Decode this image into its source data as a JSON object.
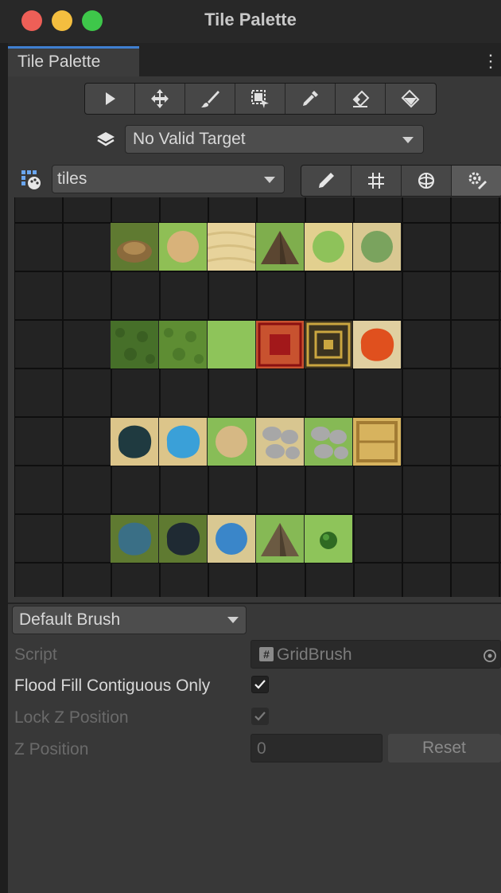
{
  "window": {
    "title": "Tile Palette"
  },
  "tab": {
    "label": "Tile Palette",
    "menu_glyph": "⋮"
  },
  "toolbar": {
    "tools": [
      "select-tool",
      "move-tool",
      "paint-brush-tool",
      "box-fill-tool",
      "pick-tool",
      "eraser-tool",
      "flood-fill-tool"
    ]
  },
  "target": {
    "value": "No Valid Target"
  },
  "palette": {
    "value": "tiles"
  },
  "palette_options": [
    "edit-pencil",
    "grid-toggle",
    "gizmo-toggle",
    "palette-settings"
  ],
  "tiles": [
    [
      {
        "name": "dirt-mound-tile",
        "bg": "#5f7a31",
        "fg": "#8b6a3c",
        "shape": "mound"
      },
      {
        "name": "grass-sand-patch-tile",
        "bg": "#8fbf55",
        "fg": "#d8b27a",
        "shape": "circle"
      },
      {
        "name": "sand-tile",
        "bg": "#e7d39b",
        "fg": "#d6bf82",
        "shape": "stripes"
      },
      {
        "name": "mountain-tile",
        "bg": "#7fae4d",
        "fg": "#5b4631",
        "shape": "peak"
      },
      {
        "name": "grass-on-sand-tile",
        "bg": "#e2d08f",
        "fg": "#8ec25a",
        "shape": "circle"
      },
      {
        "name": "grass-bush-tile",
        "bg": "#d9c892",
        "fg": "#7aa35e",
        "shape": "circle"
      }
    ],
    [
      {
        "name": "dark-grass-tile",
        "bg": "#4f7a2e",
        "fg": "#3a5f22",
        "shape": "noise"
      },
      {
        "name": "grass-texture-tile",
        "bg": "#6a9a3a",
        "fg": "#4d7a2a",
        "shape": "noise"
      },
      {
        "name": "light-grass-tile",
        "bg": "#8ec45a",
        "fg": "#85bb52",
        "shape": "plain"
      },
      {
        "name": "red-carpet-tile",
        "bg": "#c8522f",
        "fg": "#a2181a",
        "shape": "square"
      },
      {
        "name": "ornate-gold-tile",
        "bg": "#3b3320",
        "fg": "#caa640",
        "shape": "ornate"
      },
      {
        "name": "lava-tile",
        "bg": "#e0cfa0",
        "fg": "#e0501e",
        "shape": "blob"
      }
    ],
    [
      {
        "name": "dark-pond-on-sand-tile",
        "bg": "#dcc58a",
        "fg": "#1f3a40",
        "shape": "blob"
      },
      {
        "name": "water-pool-tile",
        "bg": "#dcc58a",
        "fg": "#3aa0d8",
        "shape": "blob"
      },
      {
        "name": "sand-on-grass-tile",
        "bg": "#88bd57",
        "fg": "#d6b884",
        "shape": "circle"
      },
      {
        "name": "stone-cobble-tile",
        "bg": "#d8c690",
        "fg": "#a7a7a7",
        "shape": "stones"
      },
      {
        "name": "stone-on-grass-tile",
        "bg": "#86b955",
        "fg": "#a9a9a9",
        "shape": "stones"
      },
      {
        "name": "wooden-crate-tile",
        "bg": "#d7b35e",
        "fg": "#a27b33",
        "shape": "crate"
      }
    ],
    [
      {
        "name": "pond-dirt-tile",
        "bg": "#5f7a31",
        "fg": "#3a6f86",
        "shape": "blob"
      },
      {
        "name": "dark-pond-tile",
        "bg": "#5f7a31",
        "fg": "#1f2a33",
        "shape": "blob"
      },
      {
        "name": "blue-water-tile",
        "bg": "#d9c892",
        "fg": "#3a86c9",
        "shape": "circle"
      },
      {
        "name": "mountain-range-tile",
        "bg": "#86b955",
        "fg": "#6b5a42",
        "shape": "peak"
      },
      {
        "name": "bush-tile",
        "bg": "#8ec45a",
        "fg": "#2f6a22",
        "shape": "smallcircle"
      }
    ]
  ],
  "brush": {
    "value": "Default Brush"
  },
  "inspector": {
    "script_label": "Script",
    "script_value": "GridBrush",
    "script_icon": "#",
    "flood_label": "Flood Fill Contiguous Only",
    "lock_label": "Lock Z Position",
    "zpos_label": "Z Position",
    "zpos_value": "0",
    "reset_label": "Reset",
    "flood_checked": true,
    "lock_checked": true
  }
}
